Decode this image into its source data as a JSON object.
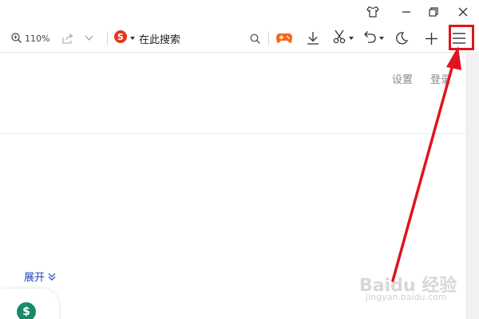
{
  "toolbar": {
    "zoom_label": "110%",
    "search_placeholder": "在此搜索"
  },
  "content": {
    "settings_link": "设置",
    "login_link": "登录",
    "expand_label": "展开"
  },
  "watermark": {
    "brand": "Baidu 经验",
    "url": "jingyan.baidu.com"
  },
  "colors": {
    "highlight": "#e0141e",
    "sogou_red": "#e8351f",
    "game_orange": "#f26a1b",
    "dollar_green": "#178a6a",
    "link_blue": "#1a3fb3"
  },
  "icons": [
    "skin-icon",
    "minimize-icon",
    "restore-icon",
    "close-icon",
    "zoom-icon",
    "share-icon",
    "chevron-down-icon",
    "sogou-logo-icon",
    "search-icon",
    "game-icon",
    "download-icon",
    "scissors-icon",
    "undo-icon",
    "moon-icon",
    "plus-icon",
    "menu-icon",
    "dollar-icon"
  ]
}
